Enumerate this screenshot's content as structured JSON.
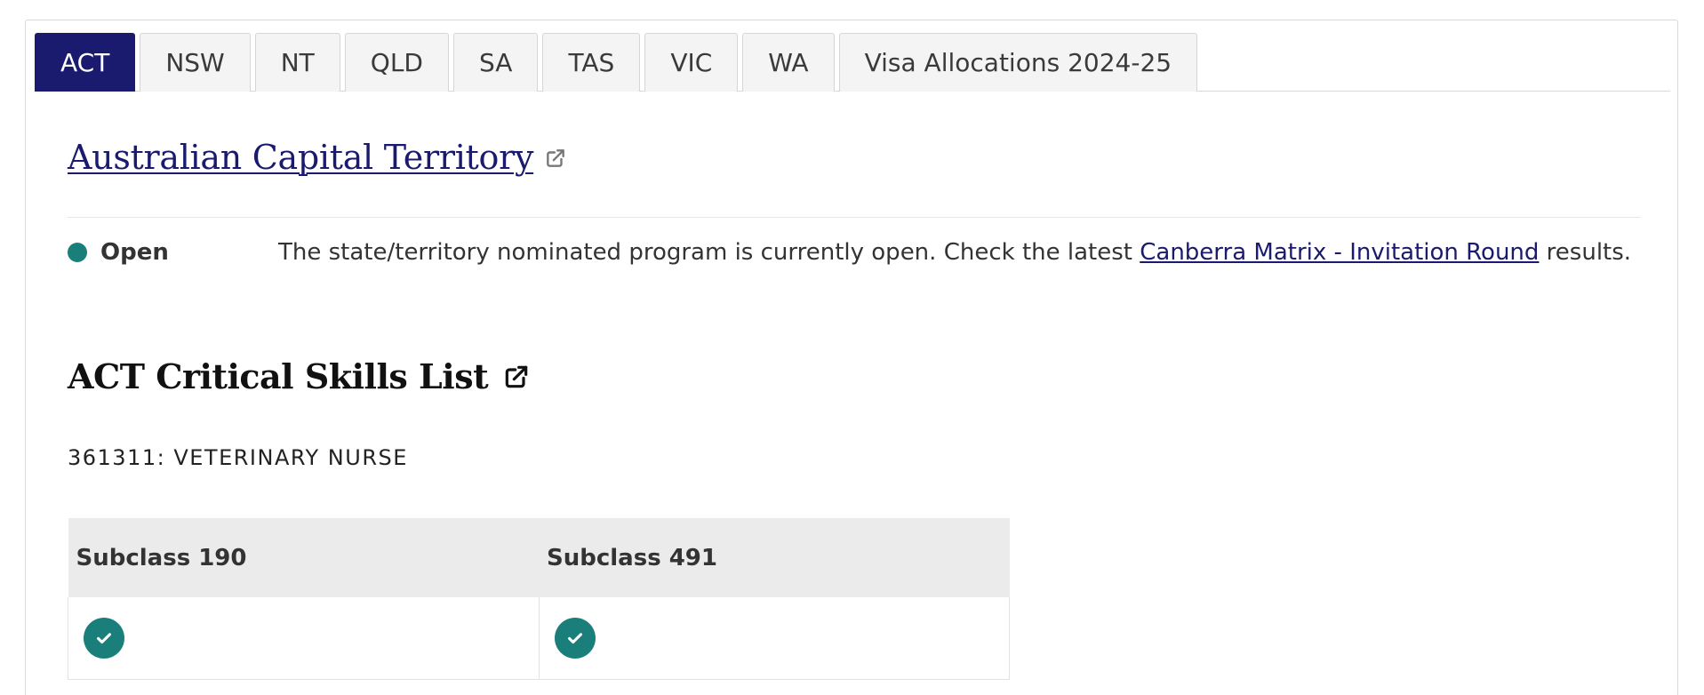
{
  "tabs": [
    {
      "label": "ACT",
      "active": true
    },
    {
      "label": "NSW",
      "active": false
    },
    {
      "label": "NT",
      "active": false
    },
    {
      "label": "QLD",
      "active": false
    },
    {
      "label": "SA",
      "active": false
    },
    {
      "label": "TAS",
      "active": false
    },
    {
      "label": "VIC",
      "active": false
    },
    {
      "label": "WA",
      "active": false
    },
    {
      "label": "Visa Allocations 2024-25",
      "active": false
    }
  ],
  "state": {
    "title": "Australian Capital Territory",
    "title_icon": "external-link-icon"
  },
  "status": {
    "label": "Open",
    "indicator_color": "#1a7f7a",
    "text_before": "The state/territory nominated program is currently open. Check the latest ",
    "link_text": "Canberra Matrix - Invitation Round",
    "text_after": " results."
  },
  "skills_list": {
    "title": "ACT Critical Skills List",
    "title_icon": "external-link-icon",
    "occupation": "361311: VETERINARY NURSE"
  },
  "visa_table": {
    "headers": [
      "Subclass 190",
      "Subclass 491"
    ],
    "rows": [
      {
        "subclass_190": "check-icon",
        "subclass_491": "check-icon"
      }
    ]
  },
  "colors": {
    "accent_navy": "#1a1a6e",
    "teal": "#1a7f7a"
  }
}
